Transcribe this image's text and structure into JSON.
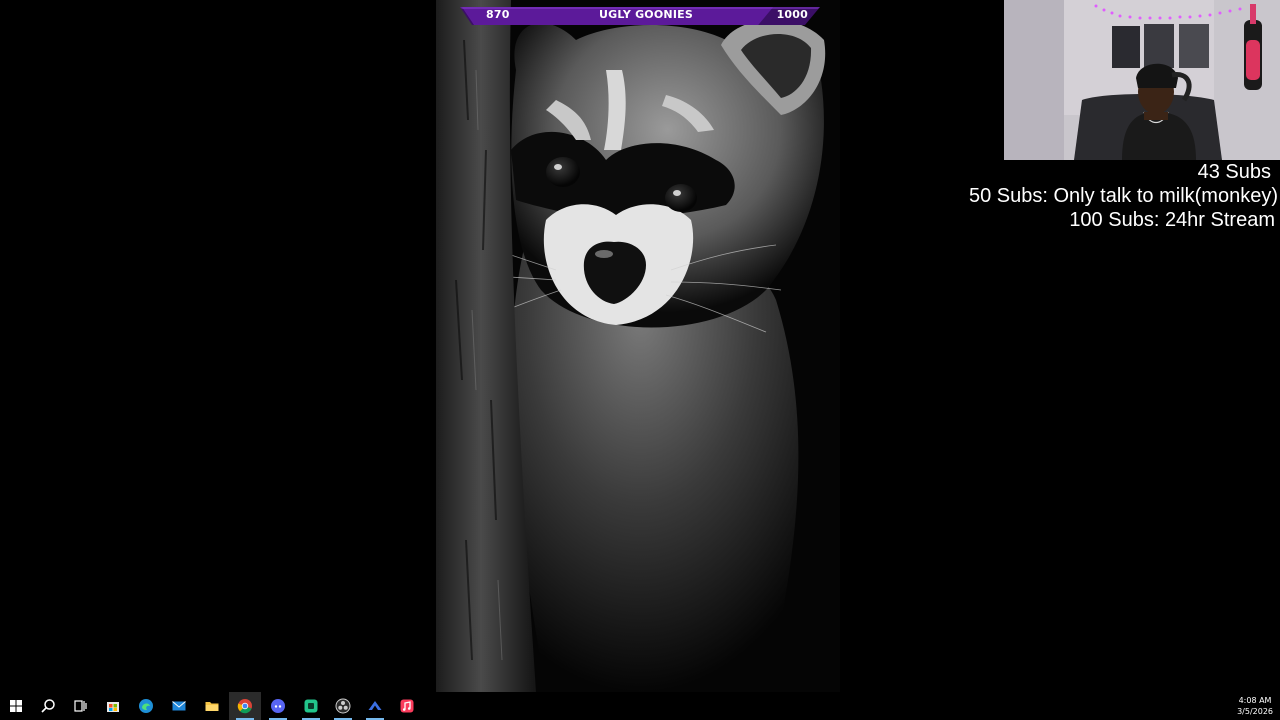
{
  "goal_bar": {
    "current": "870",
    "title": "UGLY GOONIES",
    "target": "1000",
    "progress": 0.87,
    "color": "#5c1a9a"
  },
  "sub_goals": {
    "count": "43 Subs",
    "goal_50": "50 Subs: Only talk to milk(monkey)",
    "goal_100": "100 Subs: 24hr Stream"
  },
  "taskbar": {
    "items": [
      {
        "name": "start-button",
        "icon": "windows-logo-icon"
      },
      {
        "name": "search-button",
        "icon": "search-icon"
      },
      {
        "name": "task-view-button",
        "icon": "task-view-icon"
      },
      {
        "name": "microsoft-store-button",
        "icon": "store-icon"
      },
      {
        "name": "edge-button",
        "icon": "edge-icon"
      },
      {
        "name": "mail-button",
        "icon": "mail-icon"
      },
      {
        "name": "file-explorer-button",
        "icon": "folder-icon"
      },
      {
        "name": "chrome-button",
        "icon": "chrome-icon",
        "active": true
      },
      {
        "name": "discord-button",
        "icon": "discord-icon"
      },
      {
        "name": "app-button",
        "icon": "app-icon"
      },
      {
        "name": "obs-button",
        "icon": "obs-icon"
      },
      {
        "name": "app-2-button",
        "icon": "chevron-icon"
      },
      {
        "name": "music-button",
        "icon": "music-icon"
      }
    ],
    "accent": "#76b9ed"
  },
  "clock": {
    "time": "4:08 AM",
    "date": "3/5/2026"
  }
}
